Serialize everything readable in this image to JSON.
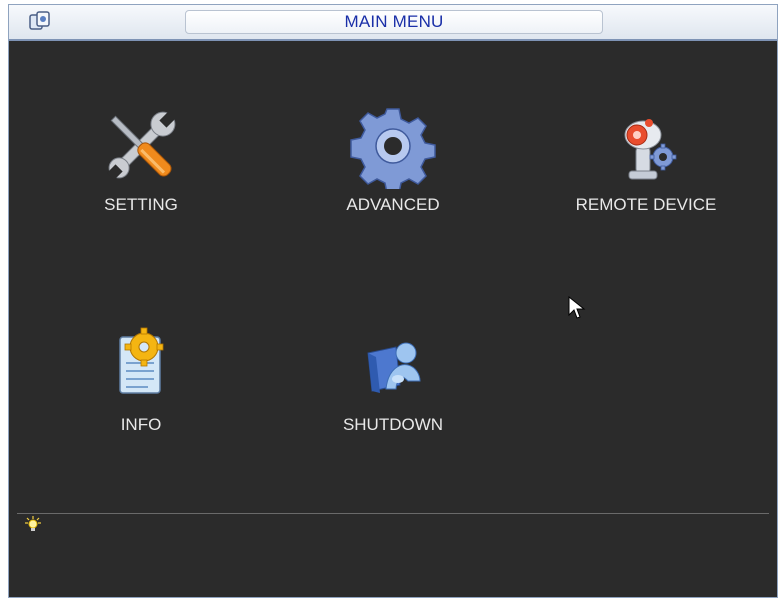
{
  "window": {
    "title": "MAIN MENU"
  },
  "menu": {
    "items": [
      {
        "label": "SETTING",
        "icon": "wrench-screwdriver-icon"
      },
      {
        "label": "ADVANCED",
        "icon": "gear-icon"
      },
      {
        "label": "REMOTE DEVICE",
        "icon": "camera-gear-icon"
      },
      {
        "label": "INFO",
        "icon": "document-gear-icon"
      },
      {
        "label": "SHUTDOWN",
        "icon": "user-shutdown-icon"
      }
    ]
  },
  "status_bar": {
    "icon": "lightbulb-icon"
  },
  "colors": {
    "background": "#2b2b2b",
    "title_text": "#1a2fa8",
    "label_text": "#e8e8e8",
    "titlebar": "#dfe6ef"
  }
}
